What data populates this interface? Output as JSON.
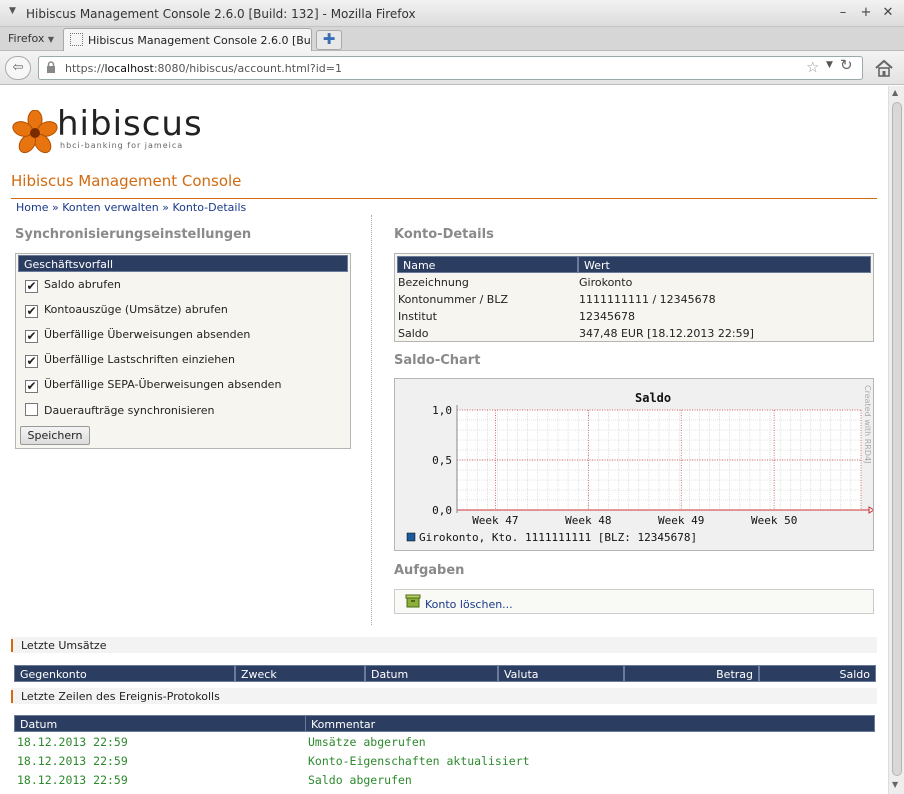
{
  "window": {
    "title": "Hibiscus Management Console 2.6.0 [Build: 132] - Mozilla Firefox"
  },
  "tabs": {
    "firefox_menu": "Firefox",
    "active_tab": "Hibiscus Management Console 2.6.0 [Build: ..."
  },
  "address": {
    "scheme": "https://",
    "host": "localhost",
    "rest": ":8080/hibiscus/account.html?id=1"
  },
  "logo": {
    "word": "hibiscus",
    "tagline": "hbci-banking for jameica"
  },
  "page": {
    "title": "Hibiscus Management Console"
  },
  "breadcrumb": {
    "home": "Home",
    "sep": " » ",
    "accounts": "Konten verwalten",
    "details": "Konto-Details"
  },
  "sync": {
    "heading": "Synchronisierungseinstellungen",
    "table_header": "Geschäftsvorfall",
    "items": [
      {
        "label": "Saldo abrufen",
        "checked": true
      },
      {
        "label": "Kontoauszüge (Umsätze) abrufen",
        "checked": true
      },
      {
        "label": "Überfällige Überweisungen absenden",
        "checked": true
      },
      {
        "label": "Überfällige Lastschriften einziehen",
        "checked": true
      },
      {
        "label": "Überfällige SEPA-Überweisungen absenden",
        "checked": true
      },
      {
        "label": "Daueraufträge synchronisieren",
        "checked": false
      }
    ],
    "save_label": "Speichern"
  },
  "details": {
    "heading": "Konto-Details",
    "col_name": "Name",
    "col_value": "Wert",
    "rows": [
      {
        "name": "Bezeichnung",
        "value": "Girokonto"
      },
      {
        "name": "Kontonummer / BLZ",
        "value": "1111111111 / 12345678"
      },
      {
        "name": "Institut",
        "value": "12345678"
      },
      {
        "name": "Saldo",
        "value": "347,48 EUR [18.12.2013 22:59]"
      }
    ]
  },
  "chart": {
    "heading": "Saldo-Chart",
    "watermark": "Created with RRD4J"
  },
  "chart_data": {
    "type": "line",
    "title": "Saldo",
    "xlabel": "",
    "ylabel": "",
    "categories": [
      "Week 47",
      "Week 48",
      "Week 49",
      "Week 50"
    ],
    "yticks": [
      "1,0",
      "0,5",
      "0,0"
    ],
    "ylim": [
      0,
      1
    ],
    "series": [
      {
        "name": "Girokonto, Kto. 1111111111 [BLZ: 12345678]",
        "values": []
      }
    ],
    "grid": true,
    "legend": "bottom-left",
    "colors": {
      "series": "#1a5a9a",
      "grid_major": "#cc3333",
      "grid_minor": "#cccccc"
    }
  },
  "tasks": {
    "heading": "Aufgaben",
    "delete_label": "Konto löschen..."
  },
  "transactions": {
    "heading": "Letzte Umsätze",
    "columns": [
      "Gegenkonto",
      "Zweck",
      "Datum",
      "Valuta",
      "Betrag",
      "Saldo"
    ]
  },
  "log": {
    "heading": "Letzte Zeilen des Ereignis-Protokolls",
    "columns": [
      "Datum",
      "Kommentar"
    ],
    "rows": [
      {
        "date": "18.12.2013 22:59",
        "comment": "Umsätze abgerufen"
      },
      {
        "date": "18.12.2013 22:59",
        "comment": "Konto-Eigenschaften aktualisiert"
      },
      {
        "date": "18.12.2013 22:59",
        "comment": "Saldo abgerufen"
      }
    ]
  },
  "colors": {
    "accent": "#d36a10",
    "header_bg": "#2c3d62",
    "log_text": "#2d8a2d"
  }
}
